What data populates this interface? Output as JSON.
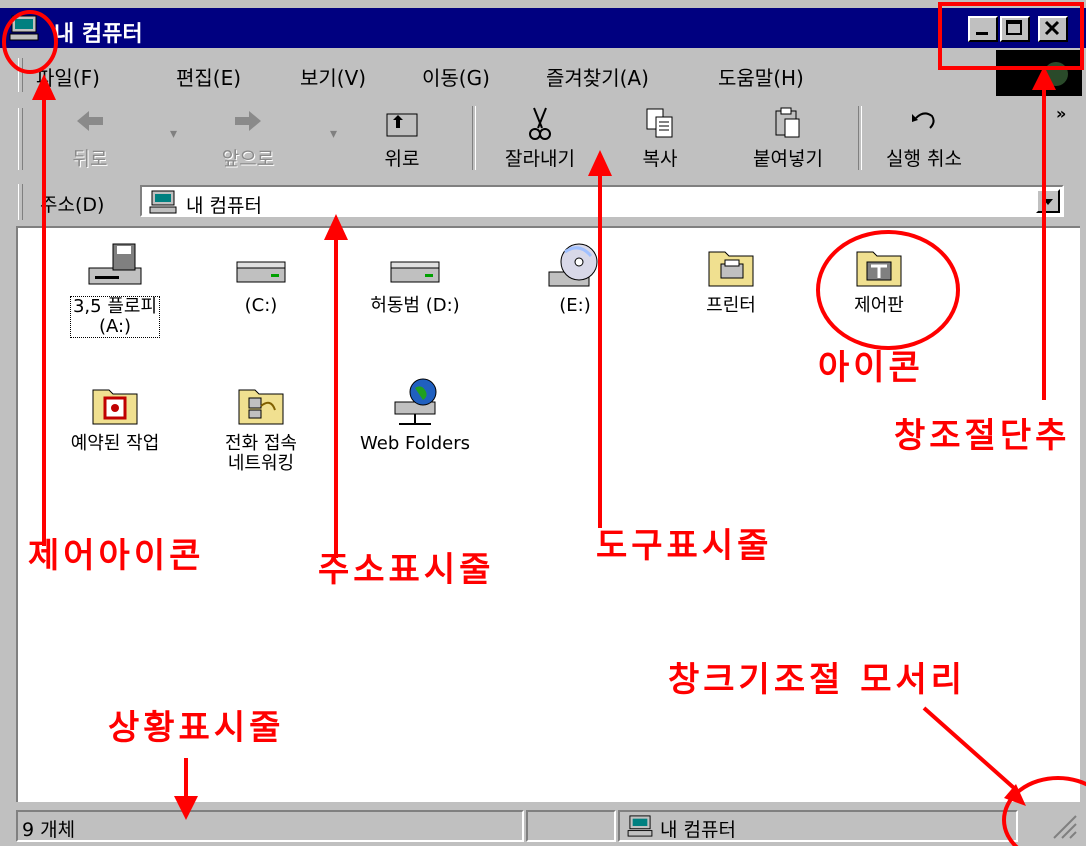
{
  "window": {
    "title": "내 컴퓨터",
    "colors": {
      "titlebar": "#000080",
      "face": "#c0c0c0",
      "annotation": "#ff0000"
    }
  },
  "menu": [
    "파일(F)",
    "편집(E)",
    "보기(V)",
    "이동(G)",
    "즐겨찾기(A)",
    "도움말(H)"
  ],
  "toolbar": {
    "back": "뒤로",
    "forward": "앞으로",
    "up": "위로",
    "cut": "잘라내기",
    "copy": "복사",
    "paste": "붙여넣기",
    "undo": "실행 취소",
    "more": "»"
  },
  "address": {
    "label": "주소(D)",
    "value": "내 컴퓨터"
  },
  "icons": [
    {
      "name": "floppy",
      "label": "3,5 플로피\n(A:)",
      "icon": "floppy-drive-icon"
    },
    {
      "name": "drive-c",
      "label": "(C:)",
      "icon": "hard-drive-icon"
    },
    {
      "name": "drive-d",
      "label": "허동범 (D:)",
      "icon": "hard-drive-icon"
    },
    {
      "name": "drive-e",
      "label": "(E:)",
      "icon": "cd-drive-icon"
    },
    {
      "name": "printers",
      "label": "프린터",
      "icon": "printer-folder-icon"
    },
    {
      "name": "control-panel",
      "label": "제어판",
      "icon": "control-panel-folder-icon"
    },
    {
      "name": "scheduled-tasks",
      "label": "예약된 작업",
      "icon": "scheduled-tasks-folder-icon"
    },
    {
      "name": "dialup-networking",
      "label": "전화 접속\n네트워킹",
      "icon": "dialup-networking-folder-icon"
    },
    {
      "name": "web-folders",
      "label": "Web Folders",
      "icon": "web-folders-icon"
    }
  ],
  "status": {
    "count": "9 개체",
    "location": "내 컴퓨터"
  },
  "annotations": {
    "control_icon": "제어아이콘",
    "address_bar": "주소표시줄",
    "toolbar": "도구표시줄",
    "icon": "아이콘",
    "window_buttons": "창조절단추",
    "resize_corner": "창크기조절 모서리",
    "status_bar": "상황표시줄"
  }
}
